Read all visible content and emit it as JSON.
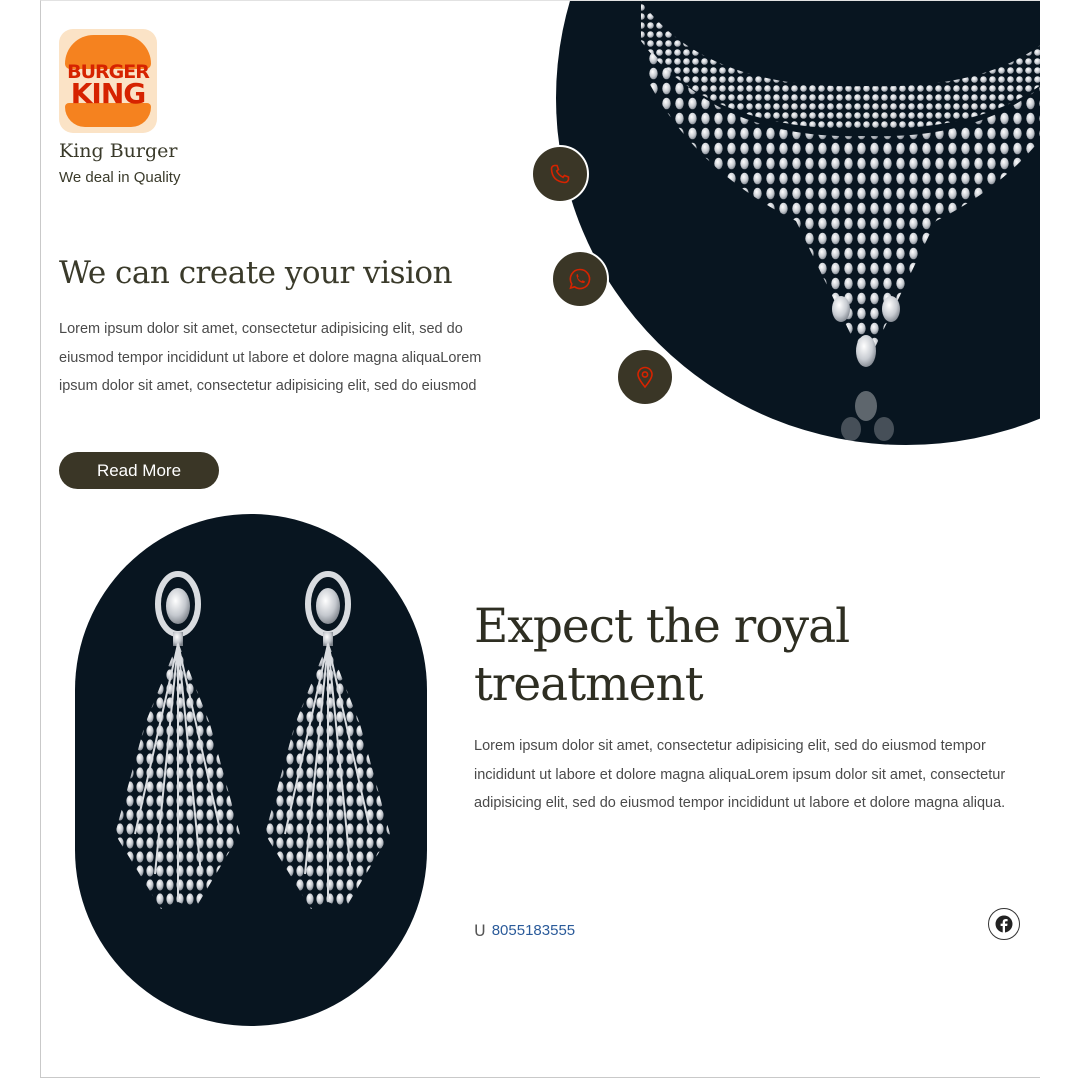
{
  "brand": {
    "logo_line1": "BURGER",
    "logo_line2": "KING",
    "name": "King Burger",
    "tagline": "We deal in Quality"
  },
  "hero": {
    "title": "We can create your vision",
    "body": "Lorem ipsum dolor sit amet, consectetur adipisicing elit, sed do eiusmod tempor incididunt ut labore et dolore magna aliquaLorem ipsum dolor sit amet, consectetur adipisicing elit, sed do eiusmod",
    "button_label": "Read More"
  },
  "contact_icons": [
    "phone-icon",
    "whatsapp-icon",
    "location-pin-icon"
  ],
  "feature": {
    "title": "Expect the royal treatment",
    "body": "Lorem ipsum dolor sit amet, consectetur adipisicing elit, sed do eiusmod tempor incididunt ut labore et dolore magna aliquaLorem ipsum dolor sit amet, consectetur adipisicing elit, sed do eiusmod tempor incididunt ut labore et dolore magna aliqua.",
    "phone_glyph": "U",
    "phone_number": "8055183555"
  },
  "social": {
    "icon": "facebook-icon"
  },
  "colors": {
    "dark_button": "#3a3626",
    "navy_panel": "#081520",
    "accent_red": "#d62300",
    "logo_orange": "#f5821f",
    "link_blue": "#2b5b9a"
  }
}
